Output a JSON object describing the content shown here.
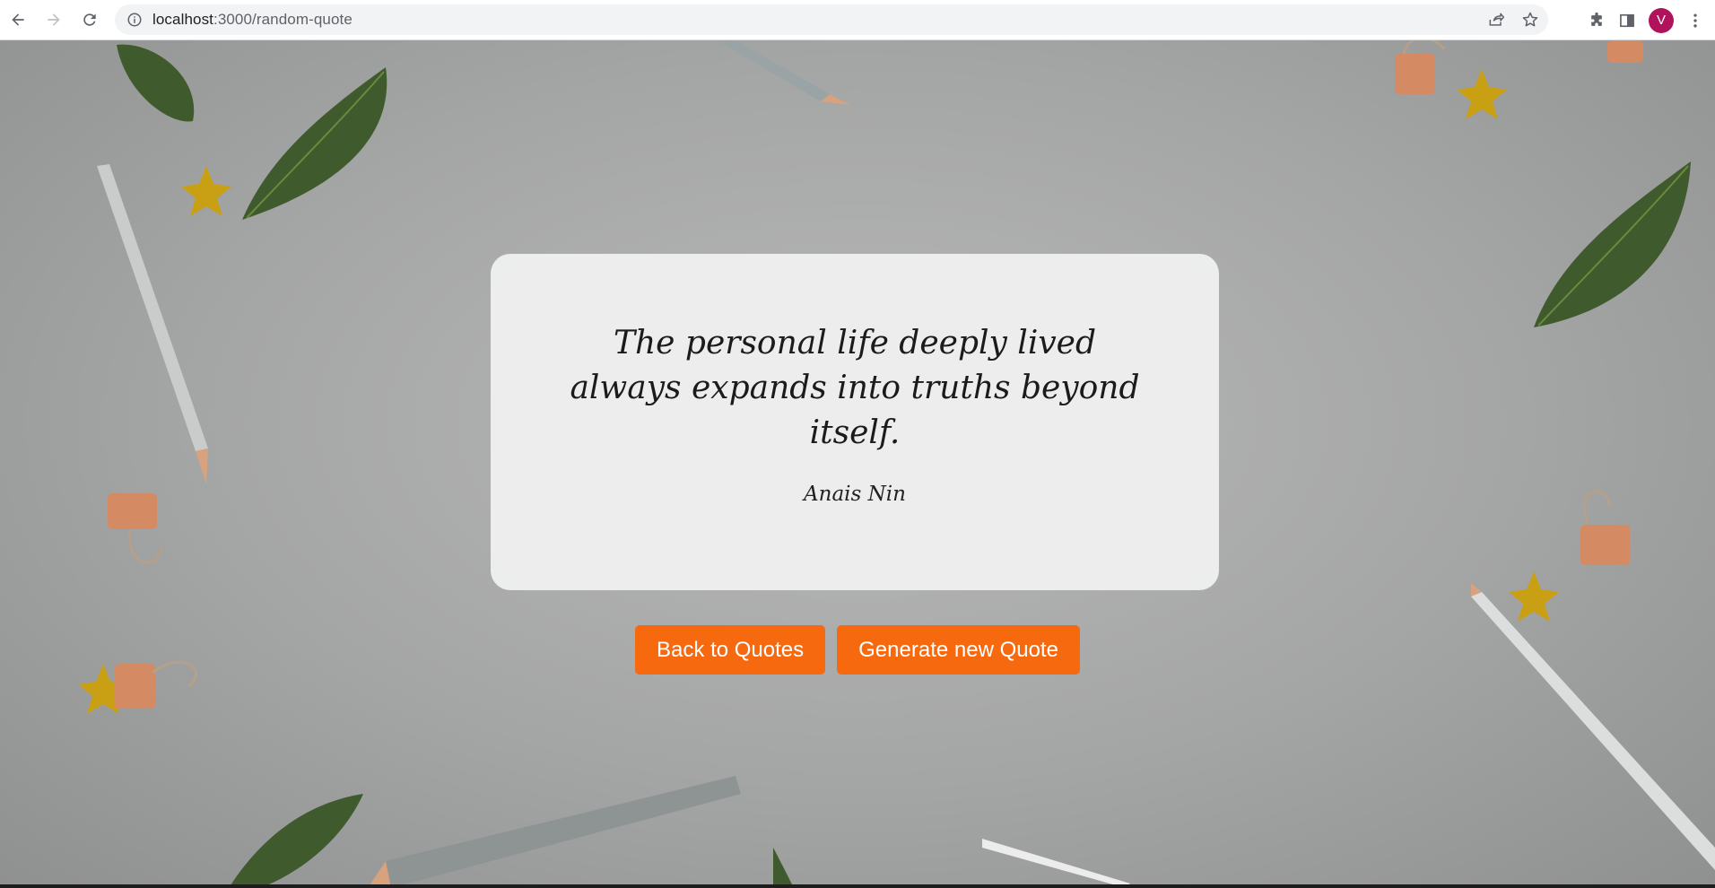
{
  "browser": {
    "url_host": "localhost",
    "url_path": ":3000/random-quote",
    "profile_initial": "V",
    "colors": {
      "profile_avatar": "#b0125b"
    }
  },
  "quote": {
    "text": "The personal life deeply lived always expands into truths beyond itself.",
    "author": "Anais Nin"
  },
  "actions": {
    "back_label": "Back to Quotes",
    "generate_label": "Generate new Quote",
    "button_color": "#f7690f"
  },
  "icons": [
    "back-arrow-icon",
    "forward-arrow-icon",
    "reload-icon",
    "info-icon",
    "share-icon",
    "star-icon",
    "extensions-icon",
    "side-panel-icon",
    "more-menu-icon"
  ]
}
